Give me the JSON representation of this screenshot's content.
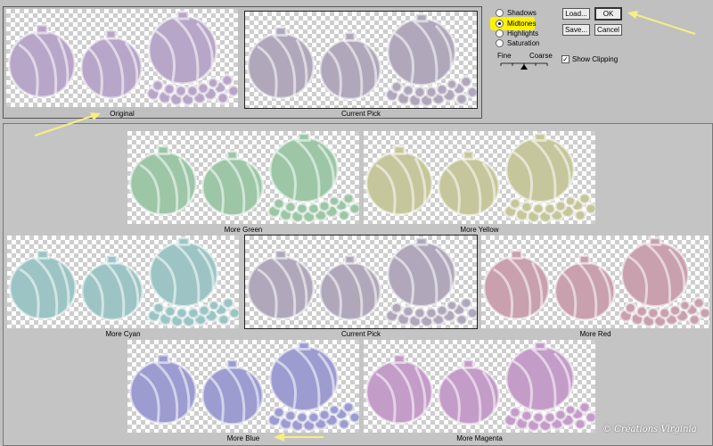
{
  "dialog": {
    "tonal_range": {
      "options": [
        {
          "label": "Shadows",
          "selected": false
        },
        {
          "label": "Midtones",
          "selected": true
        },
        {
          "label": "Highlights",
          "selected": false
        },
        {
          "label": "Saturation",
          "selected": false
        }
      ],
      "highlight_color": "#fff200"
    },
    "fine_coarse": {
      "fine_label": "Fine",
      "coarse_label": "Coarse"
    },
    "show_clipping": {
      "label": "Show Clipping",
      "checked": true
    },
    "buttons": {
      "load": "Load...",
      "save": "Save...",
      "ok": "OK",
      "cancel": "Cancel"
    }
  },
  "top_previews": {
    "original": "Original",
    "current_pick": "Current Pick"
  },
  "variations": {
    "more_green": "More Green",
    "more_yellow": "More Yellow",
    "more_cyan": "More Cyan",
    "current_pick": "Current Pick",
    "more_red": "More Red",
    "more_blue": "More Blue",
    "more_magenta": "More Magenta"
  },
  "tints": {
    "original": "#b8a6c8",
    "current_pick": "#b0a8ba",
    "more_green": "#9cc6a6",
    "more_yellow": "#c6c69c",
    "more_cyan": "#9cc4c4",
    "more_red": "#c8a0ae",
    "more_blue": "#9c9cd0",
    "more_magenta": "#c49cc8"
  },
  "watermark": "© Créations Virginia",
  "arrow_color": "#f4f080"
}
